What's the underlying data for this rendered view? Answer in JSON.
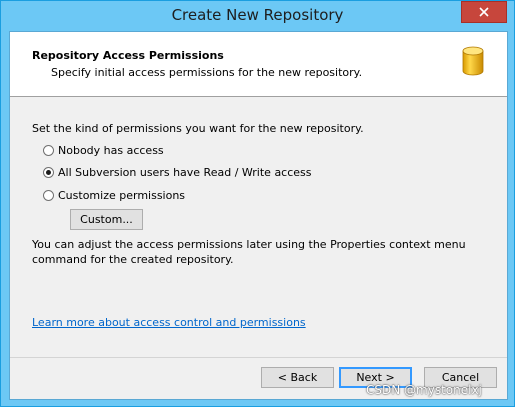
{
  "window": {
    "title": "Create New Repository"
  },
  "header": {
    "title": "Repository Access Permissions",
    "subtitle": "Specify initial access permissions for the new repository.",
    "icon": "database-icon"
  },
  "content": {
    "intro": "Set the kind of permissions you want for the new repository.",
    "options": [
      {
        "label": "Nobody has access",
        "checked": false
      },
      {
        "label": "All Subversion users have Read / Write access",
        "checked": true
      },
      {
        "label": "Customize permissions",
        "checked": false
      }
    ],
    "custom_button": "Custom...",
    "note": "You can adjust the access permissions later using the Properties context menu command for the created repository.",
    "learn_more_link": "Learn more about access control and permissions"
  },
  "footer": {
    "back_label": "< Back",
    "next_label": "Next >",
    "cancel_label": "Cancel"
  },
  "watermark": "CSDN @mystonelxj",
  "colors": {
    "titlebar": "#6cc8f5",
    "close": "#c7463c",
    "link": "#0066cc"
  }
}
